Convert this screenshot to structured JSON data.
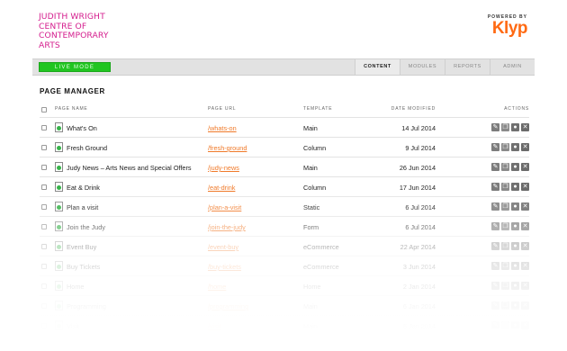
{
  "brand": {
    "lines": [
      "JUDITH WRIGHT",
      "CENTRE OF",
      "CONTEMPORARY",
      "ARTS"
    ]
  },
  "powered_by": {
    "label": "POWERED BY",
    "logo_text": "Klyp"
  },
  "navbar": {
    "live_mode": "LIVE MODE",
    "tabs": [
      {
        "label": "CONTENT",
        "active": true
      },
      {
        "label": "MODULES",
        "active": false
      },
      {
        "label": "REPORTS",
        "active": false
      },
      {
        "label": "ADMIN",
        "active": false
      }
    ]
  },
  "page": {
    "title": "PAGE MANAGER"
  },
  "table": {
    "headers": {
      "name": "PAGE NAME",
      "url": "PAGE URL",
      "template": "TEMPLATE",
      "date": "DATE MODIFIED",
      "actions": "ACTIONS"
    },
    "rows": [
      {
        "name": "What's On",
        "url": "/whats-on",
        "template": "Main",
        "date": "14 Jul 2014"
      },
      {
        "name": "Fresh Ground",
        "url": "/fresh-ground",
        "template": "Column",
        "date": "9 Jul 2014"
      },
      {
        "name": "Judy News – Arts News and Special Offers",
        "url": "/judy-news",
        "template": "Main",
        "date": "26 Jun 2014"
      },
      {
        "name": "Eat & Drink",
        "url": "/eat-drink",
        "template": "Column",
        "date": "17 Jun 2014"
      },
      {
        "name": "Plan a visit",
        "url": "/plan-a-visit",
        "template": "Static",
        "date": "6 Jul 2014"
      },
      {
        "name": "Join the Judy",
        "url": "/join-the-judy",
        "template": "Form",
        "date": "6 Jul 2014"
      },
      {
        "name": "Event Buy",
        "url": "/event-buy",
        "template": "eCommerce",
        "date": "22 Apr 2014"
      },
      {
        "name": "Buy Tickets",
        "url": "/buy-tickets",
        "template": "eCommerce",
        "date": "3 Jun 2014"
      },
      {
        "name": "Home",
        "url": "/home",
        "template": "Home",
        "date": "2 Jan 2014"
      },
      {
        "name": "Programming",
        "url": "/programming",
        "template": "Main",
        "date": "6 Jan 2014"
      },
      {
        "name": "Visit",
        "url": "/visit",
        "template": "Main",
        "date": "6 Jan 2014"
      }
    ]
  },
  "colors": {
    "brand": "#d41c8d",
    "accent": "#ff6a13",
    "live": "#21c521",
    "link": "#f07a2a"
  },
  "icons": {
    "row_actions": [
      "edit-icon",
      "duplicate-icon",
      "preview-icon",
      "delete-icon"
    ],
    "page": "page-document-icon"
  }
}
